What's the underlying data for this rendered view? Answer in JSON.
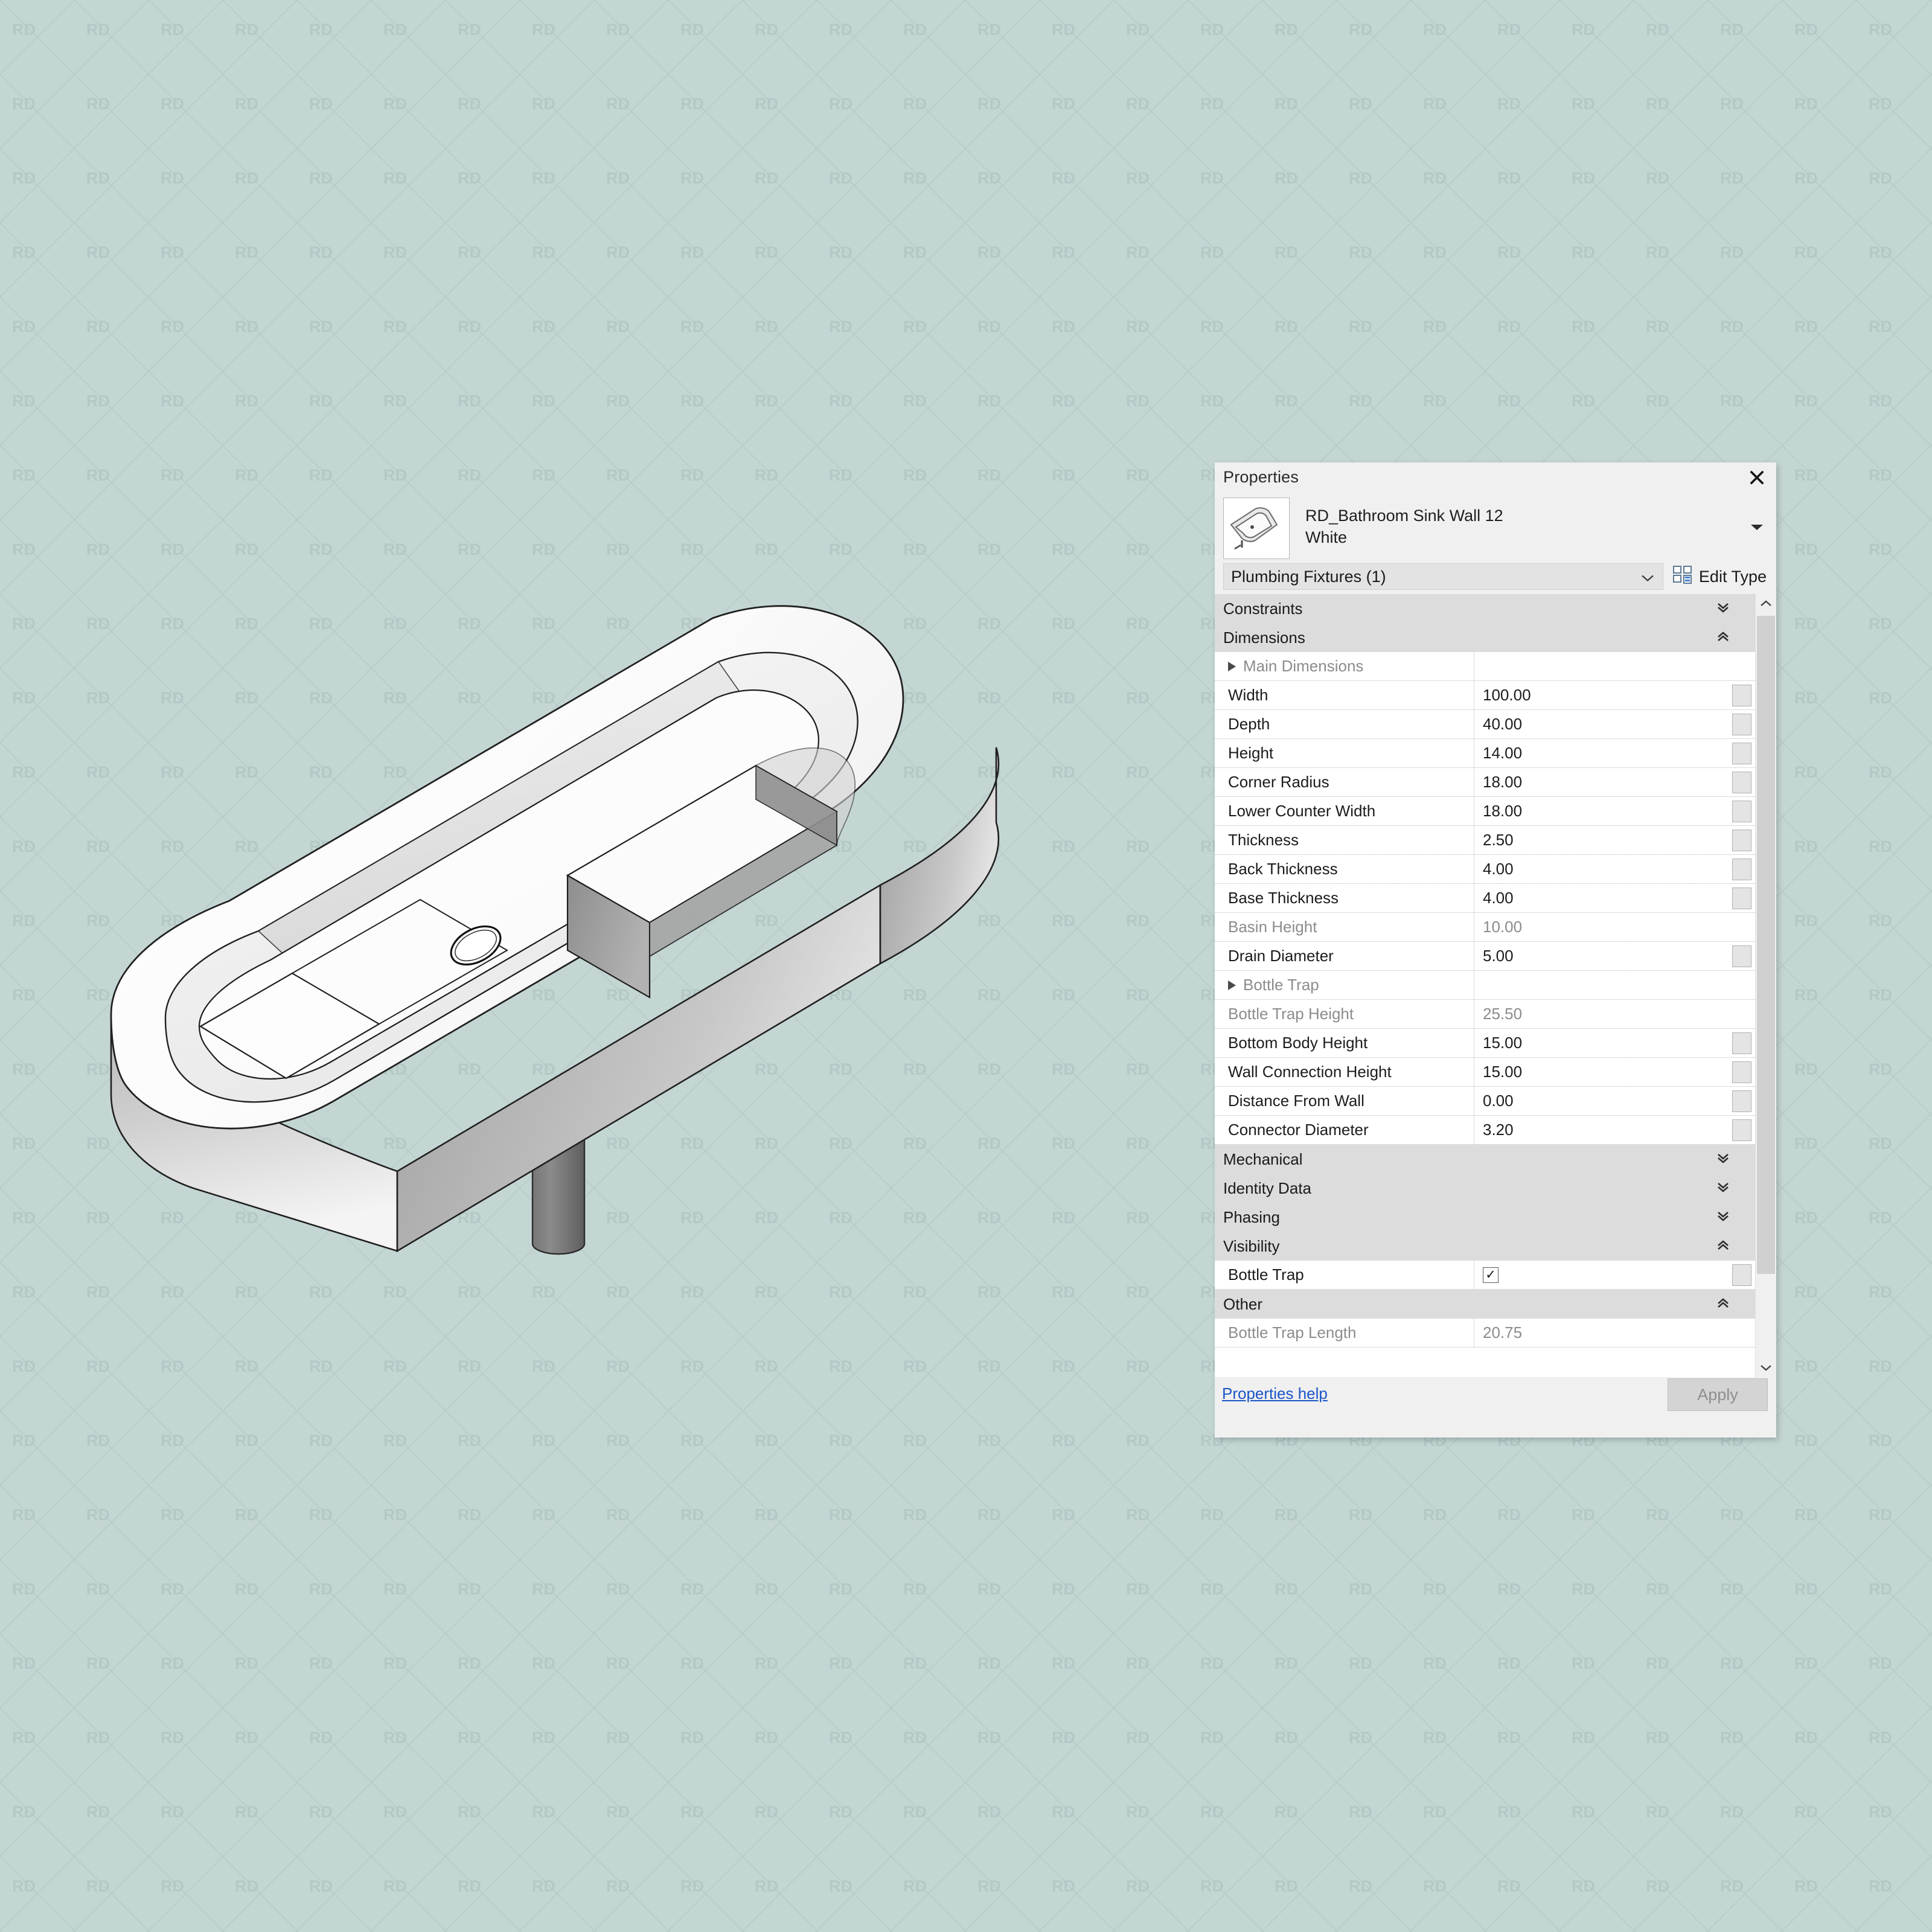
{
  "background": {
    "color": "#c4d6d4",
    "watermark_text": "RD",
    "watermark_color": "#b3c7c5"
  },
  "model": {
    "name": "RD_Bathroom Sink Wall 12 White",
    "description": "Isometric 3D shaded view of a wall-mounted rectangular bathroom sink with one rounded end, an integrated lower counter shelf, a circular drain and a cylindrical bottle trap leg."
  },
  "panel": {
    "title": "Properties",
    "close_icon": "close-icon",
    "type_name_line1": "RD_Bathroom Sink Wall 12",
    "type_name_line2": "White",
    "type_dropdown_icon": "chevron-down-icon",
    "category": "Plumbing Fixtures (1)",
    "category_caret_icon": "chevron-down-icon",
    "edit_type_label": "Edit Type",
    "edit_type_icon": "edit-type-icon",
    "help_link": "Properties help",
    "apply_label": "Apply",
    "scrollbar": {
      "up_arrow_icon": "chevron-up-icon",
      "down_arrow_icon": "chevron-down-icon"
    }
  },
  "rows": [
    {
      "kind": "group",
      "label": "Constraints",
      "chevron": "»"
    },
    {
      "kind": "group",
      "label": "Dimensions",
      "chevron": "«"
    },
    {
      "kind": "expander",
      "label": "Main Dimensions",
      "value": "",
      "readonly": true,
      "spinner": false
    },
    {
      "kind": "data",
      "label": "Width",
      "value": "100.00",
      "readonly": false,
      "spinner": true
    },
    {
      "kind": "data",
      "label": "Depth",
      "value": "40.00",
      "readonly": false,
      "spinner": true
    },
    {
      "kind": "data",
      "label": "Height",
      "value": "14.00",
      "readonly": false,
      "spinner": true
    },
    {
      "kind": "data",
      "label": "Corner Radius",
      "value": "18.00",
      "readonly": false,
      "spinner": true
    },
    {
      "kind": "data",
      "label": "Lower Counter Width",
      "value": "18.00",
      "readonly": false,
      "spinner": true
    },
    {
      "kind": "data",
      "label": "Thickness",
      "value": "2.50",
      "readonly": false,
      "spinner": true
    },
    {
      "kind": "data",
      "label": "Back Thickness",
      "value": "4.00",
      "readonly": false,
      "spinner": true
    },
    {
      "kind": "data",
      "label": "Base Thickness",
      "value": "4.00",
      "readonly": false,
      "spinner": true
    },
    {
      "kind": "data",
      "label": "Basin Height",
      "value": "10.00",
      "readonly": true,
      "spinner": false
    },
    {
      "kind": "data",
      "label": "Drain Diameter",
      "value": "5.00",
      "readonly": false,
      "spinner": true
    },
    {
      "kind": "expander",
      "label": "Bottle Trap",
      "value": "",
      "readonly": true,
      "spinner": false
    },
    {
      "kind": "data",
      "label": "Bottle Trap Height",
      "value": "25.50",
      "readonly": true,
      "spinner": false
    },
    {
      "kind": "data",
      "label": "Bottom Body Height",
      "value": "15.00",
      "readonly": false,
      "spinner": true
    },
    {
      "kind": "data",
      "label": "Wall Connection Height",
      "value": "15.00",
      "readonly": false,
      "spinner": true
    },
    {
      "kind": "data",
      "label": "Distance From Wall",
      "value": "0.00",
      "readonly": false,
      "spinner": true
    },
    {
      "kind": "data",
      "label": "Connector Diameter",
      "value": "3.20",
      "readonly": false,
      "spinner": true
    },
    {
      "kind": "group",
      "label": "Mechanical",
      "chevron": "»"
    },
    {
      "kind": "group",
      "label": "Identity Data",
      "chevron": "»"
    },
    {
      "kind": "group",
      "label": "Phasing",
      "chevron": "»"
    },
    {
      "kind": "group",
      "label": "Visibility",
      "chevron": "«"
    },
    {
      "kind": "checkbox",
      "label": "Bottle Trap",
      "value": "✓",
      "checked": true,
      "readonly": false,
      "spinner": true
    },
    {
      "kind": "group",
      "label": "Other",
      "chevron": "«"
    },
    {
      "kind": "data",
      "label": "Bottle Trap Length",
      "value": "20.75",
      "readonly": true,
      "spinner": false
    }
  ]
}
